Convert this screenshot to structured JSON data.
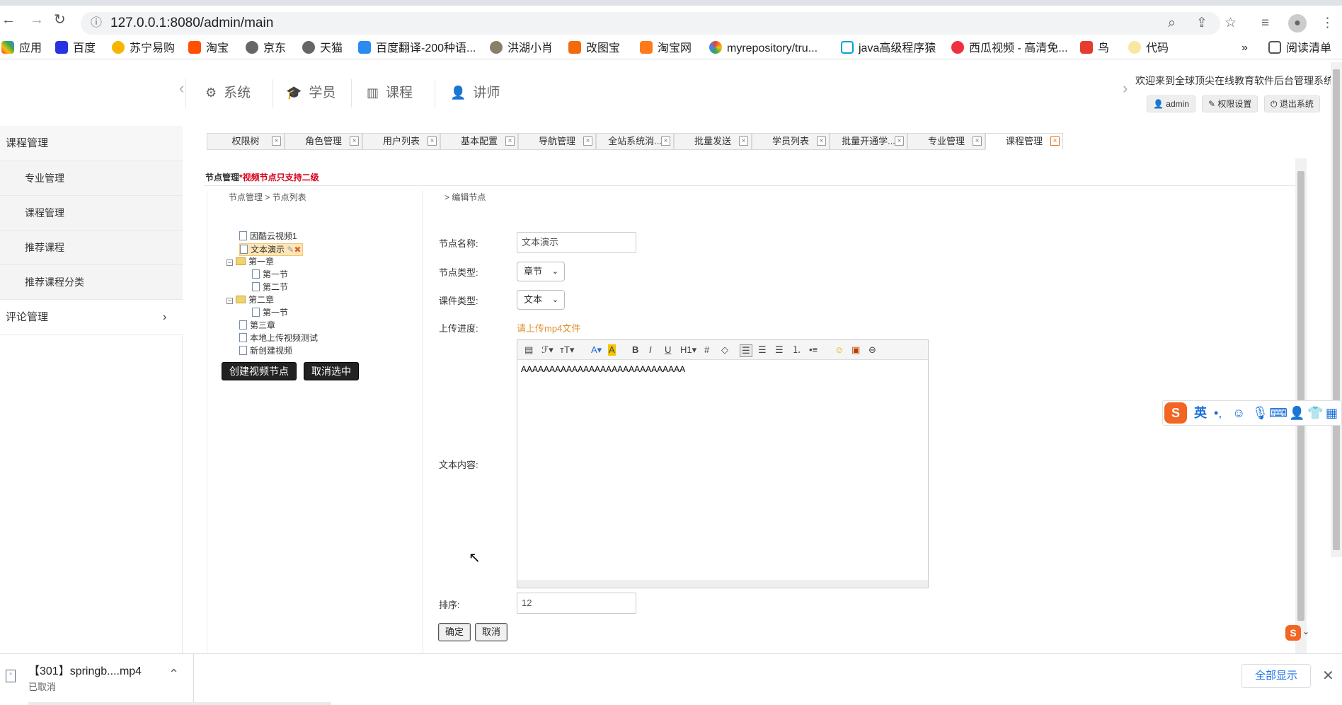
{
  "browser": {
    "url": "127.0.0.1:8080/admin/main",
    "bookmarks": [
      "应用",
      "百度",
      "苏宁易购",
      "淘宝",
      "京东",
      "天猫",
      "百度翻译-200种语...",
      "洪湖小肖",
      "改图宝",
      "淘宝网",
      "myrepository/tru...",
      "java高级程序猿",
      "西瓜视频 - 高清免...",
      "鸟",
      "代码"
    ],
    "more_label": "»",
    "reading_list": "阅读清单"
  },
  "header": {
    "nav": [
      "系统",
      "学员",
      "课程",
      "讲师"
    ],
    "welcome": "欢迎来到全球顶尖在线教育软件后台管理系统!",
    "user_btn": "admin",
    "perm_btn": "权限设置",
    "logout_btn": "退出系统"
  },
  "sidebar": {
    "group1": "课程管理",
    "items": [
      "专业管理",
      "课程管理",
      "推荐课程",
      "推荐课程分类"
    ],
    "group2": "评论管理",
    "arrow": "›"
  },
  "tabs": [
    "权限树",
    "角色管理",
    "用户列表",
    "基本配置",
    "导航管理",
    "全站系统消...",
    "批量发送",
    "学员列表",
    "批量开通学...",
    "专业管理",
    "课程管理"
  ],
  "content": {
    "title": "节点管理",
    "warning": "*视频节点只支持二级",
    "breadcrumb_left": "节点管理 > 节点列表",
    "breadcrumb_right": "> 编辑节点",
    "tree": {
      "n1": "因酷云视频1",
      "n2": "文本演示",
      "n3": "第一章",
      "n3a": "第一节",
      "n3b": "第二节",
      "n4": "第二章",
      "n4a": "第一节",
      "n5": "第三章",
      "n6": "本地上传视频测试",
      "n7": "新创建视频"
    },
    "create_btn": "创建视频节点",
    "cancel_sel_btn": "取消选中",
    "form": {
      "name_label": "节点名称:",
      "name_value": "文本演示",
      "type_label": "节点类型:",
      "type_value": "章节",
      "course_type_label": "课件类型:",
      "course_type_value": "文本",
      "upload_label": "上传进度:",
      "upload_hint": "请上传mp4文件",
      "text_label": "文本内容:",
      "text_value": "AAAAAAAAAAAAAAAAAAAAAAAAAAAAA",
      "sort_label": "排序:",
      "sort_value": "12",
      "ok_btn": "确定",
      "cancel_btn": "取消"
    }
  },
  "ime": {
    "lang": "英"
  },
  "download": {
    "filename": "【301】springb....mp4",
    "status": "已取消",
    "show_all": "全部显示"
  },
  "colors": {
    "warning": "#d9001b",
    "upload_hint": "#e0902a",
    "accent": "#e07020"
  }
}
